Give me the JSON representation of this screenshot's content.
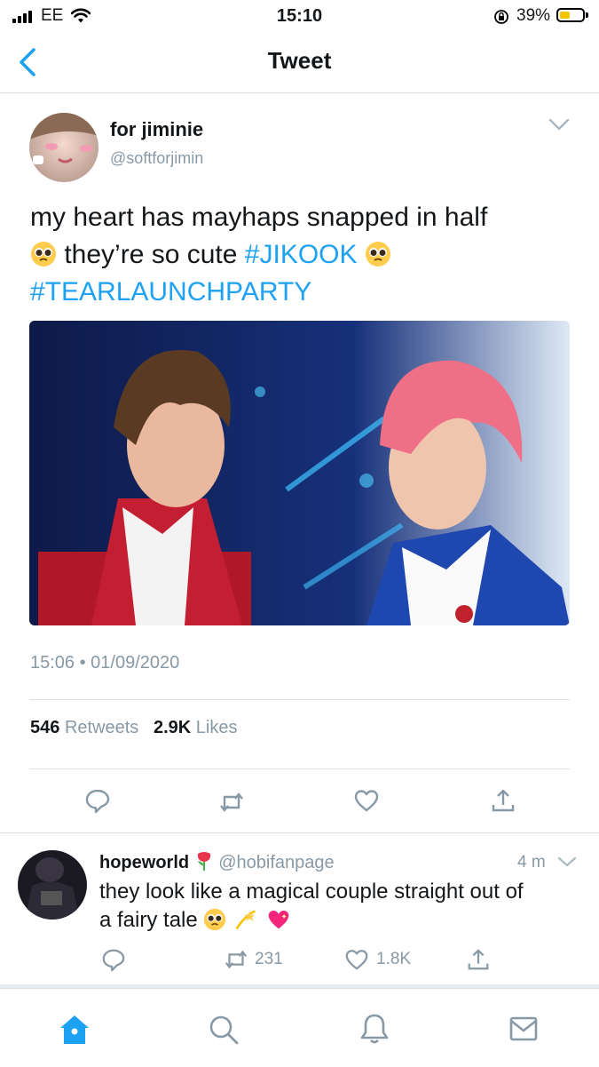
{
  "status_bar": {
    "carrier": "EE",
    "time": "15:10",
    "battery_percent": "39%",
    "battery_level": 0.39
  },
  "header": {
    "title": "Tweet"
  },
  "tweet": {
    "author_name": "for jiminie",
    "author_handle": "@softforjimin",
    "text_line1": "my heart has mayhaps snapped in half",
    "text_line2_a": "they’re so cute",
    "hashtag1": "#JIKOOK",
    "hashtag2": "#TEARLAUNCHPARTY",
    "timestamp": "15:06 • 01/09/2020",
    "retweet_count": "546",
    "retweet_label": "Retweets",
    "like_count": "2.9K",
    "like_label": "Likes"
  },
  "reply": {
    "author_name": "hopeworld",
    "author_handle": "@hobifanpage",
    "time_ago": "4 m",
    "text_line1": "they look like a magical couple straight out of",
    "text_line2": "a fairy tale",
    "retweet_count": "231",
    "like_count": "1.8K"
  },
  "colors": {
    "accent": "#1da1f2",
    "muted": "#8899a6",
    "text": "#14171a",
    "battery": "#f5c400"
  },
  "icons": [
    "signal-icon",
    "wifi-icon",
    "lock-rotation-icon",
    "battery-icon",
    "back-chevron-icon",
    "chevron-down-icon",
    "reply-icon",
    "retweet-icon",
    "like-icon",
    "share-icon",
    "home-icon",
    "search-icon",
    "notifications-icon",
    "messages-icon",
    "pleading-face-emoji",
    "rose-emoji",
    "dizzy-emoji",
    "sparkling-heart-emoji"
  ]
}
